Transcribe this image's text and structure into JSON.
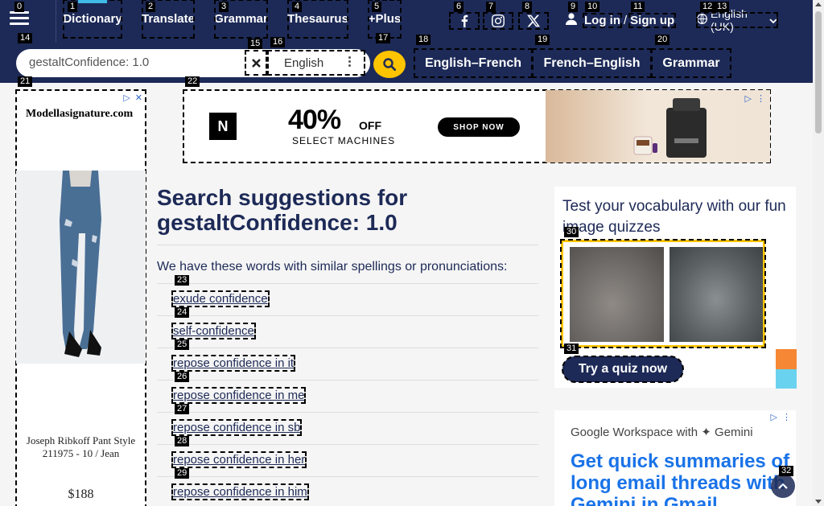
{
  "header": {
    "nav": [
      "Dictionary",
      "Translate",
      "Grammar",
      "Thesaurus",
      "+Plus"
    ],
    "social": [
      "facebook-icon",
      "instagram-icon",
      "x-icon"
    ],
    "login": "Log in",
    "slash": "/",
    "signup": "Sign up",
    "language": "English (UK)"
  },
  "search": {
    "value": "gestaltConfidence: 1.0",
    "dataset": "English",
    "links": [
      "English–French",
      "French–English",
      "Grammar"
    ]
  },
  "left_ad": {
    "brand": "Modellasignature.com",
    "product": "Joseph Ribkoff Pant Style 211975 - 10 / Jean",
    "price": "$188"
  },
  "banner_ad": {
    "headline": "40%",
    "off": "OFF",
    "sub": "SELECT MACHINES",
    "cta": "SHOP NOW",
    "logo": "N"
  },
  "main": {
    "title_prefix": "Search suggestions for",
    "title_term": "gestaltConfidence: 1.0",
    "intro": "We have these words with similar spellings or pronunciations:",
    "suggestions": [
      "exude confidence",
      "self-confidence",
      "repose confidence in it",
      "repose confidence in me",
      "repose confidence in sb",
      "repose confidence in her",
      "repose confidence in him"
    ]
  },
  "quiz": {
    "title": "Test your vocabulary with our fun image quizzes",
    "button": "Try a quiz now"
  },
  "right_ad": {
    "brand": "Google Workspace with ✦ Gemini",
    "headline": "Get quick summaries of long email threads with Gemini in Gmail."
  },
  "marks": [
    "0",
    "1",
    "2",
    "3",
    "4",
    "5",
    "6",
    "7",
    "8",
    "9",
    "10",
    "11",
    "12",
    "13",
    "14",
    "15",
    "16",
    "17",
    "18",
    "19",
    "20",
    "21",
    "22",
    "23",
    "24",
    "25",
    "26",
    "27",
    "28",
    "29",
    "30",
    "31",
    "32"
  ]
}
